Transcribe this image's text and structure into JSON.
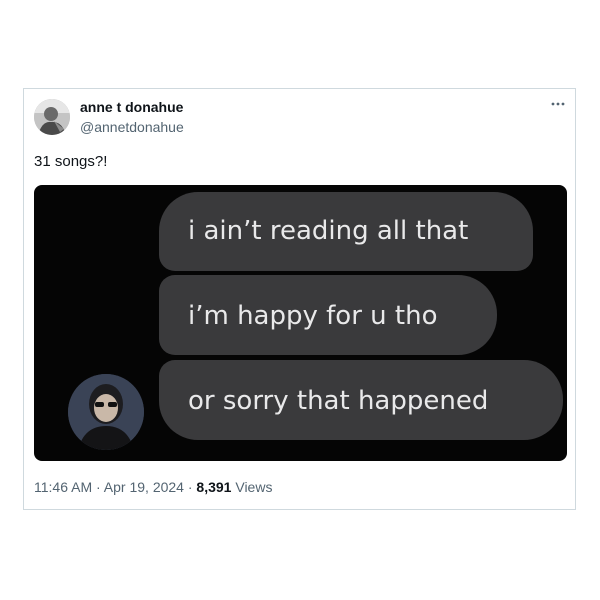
{
  "author": {
    "name": "anne t donahue",
    "handle": "@annetdonahue"
  },
  "more_icon": "more-horizontal-icon",
  "tweet": {
    "text": "31 songs?!"
  },
  "media": {
    "messages": [
      "i ain’t reading all that",
      "i’m happy for u tho",
      "or sorry that happened"
    ]
  },
  "meta": {
    "time": "11:46 AM",
    "sep1": " · ",
    "date": "Apr 19, 2024",
    "sep2": " · ",
    "views_count": "8,391",
    "views_label": " Views"
  }
}
